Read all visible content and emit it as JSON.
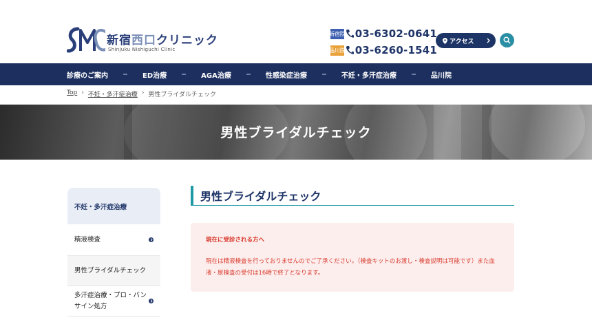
{
  "header": {
    "logo": {
      "name_main": "新宿",
      "name_accent": "西口",
      "name_tail": "クリニック",
      "subtitle": "Shinjuku Nishiguchi Clinic"
    },
    "phones": [
      {
        "tag": "新宿院",
        "number": "03-6302-0641",
        "color": "#3d5fb0"
      },
      {
        "tag": "品川院",
        "number": "03-6260-1541",
        "color": "#e9a23a"
      }
    ],
    "access_label": "アクセス"
  },
  "nav": {
    "items": [
      "診療のご案内",
      "ED治療",
      "AGA治療",
      "性感染症治療",
      "不妊・多汗症治療",
      "品川院"
    ]
  },
  "breadcrumb": [
    "Top",
    "不妊・多汗症治療",
    "男性ブライダルチェック"
  ],
  "hero": {
    "title": "男性ブライダルチェック"
  },
  "sidebar": {
    "heading": "不妊・多汗症治療",
    "items": [
      {
        "label": "精液検査"
      },
      {
        "label": "男性ブライダルチェック"
      },
      {
        "label": "多汗症治療・プロ・バンサイン処方"
      }
    ]
  },
  "main": {
    "title": "男性ブライダルチェック",
    "notice": {
      "title": "現在に受診される方へ",
      "body": "現在は精液検査を行っておりませんのでご了承ください。（検査キットのお渡し・検査説明は可能です）また血液・尿検査の受付は16時で終了となります。"
    }
  },
  "colors": {
    "navy": "#1c2f5e",
    "teal": "#1f9aa5",
    "alert_red": "#d8392b",
    "alert_bg": "#fdeeee"
  }
}
